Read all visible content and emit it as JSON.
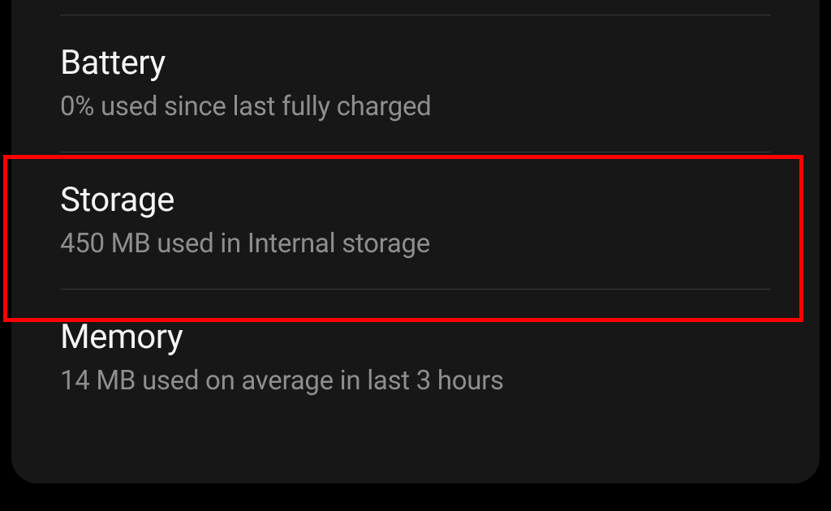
{
  "settings": {
    "battery": {
      "title": "Battery",
      "subtitle": "0% used since last fully charged"
    },
    "storage": {
      "title": "Storage",
      "subtitle": "450 MB used in Internal storage"
    },
    "memory": {
      "title": "Memory",
      "subtitle": "14 MB used on average in last 3 hours"
    }
  }
}
